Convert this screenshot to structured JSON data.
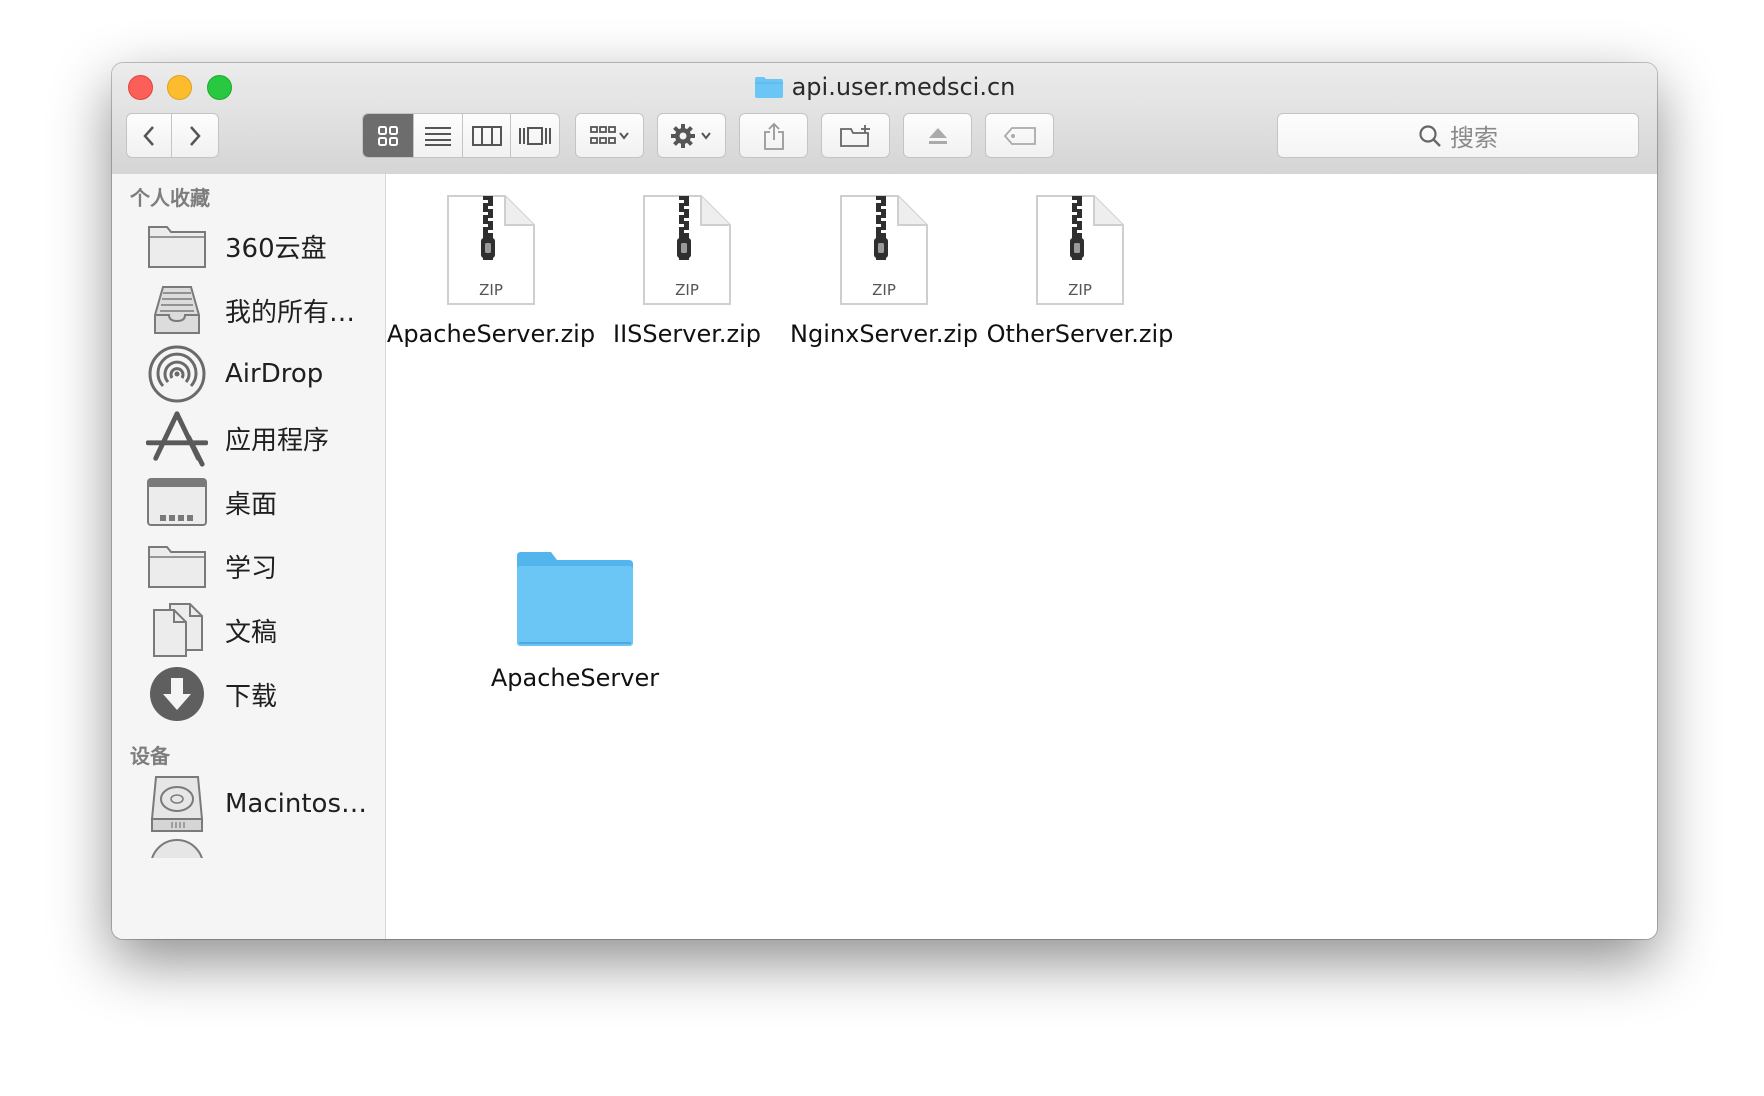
{
  "window": {
    "title": "api.user.medsci.cn"
  },
  "toolbar": {
    "search_placeholder": "搜索"
  },
  "sidebar": {
    "favorites_header": "个人收藏",
    "favorites": [
      {
        "label": "360云盘",
        "icon": "folder-icon"
      },
      {
        "label": "我的所有…",
        "icon": "all-files-icon"
      },
      {
        "label": "AirDrop",
        "icon": "airdrop-icon"
      },
      {
        "label": "应用程序",
        "icon": "applications-icon"
      },
      {
        "label": "桌面",
        "icon": "desktop-icon"
      },
      {
        "label": "学习",
        "icon": "folder-icon"
      },
      {
        "label": "文稿",
        "icon": "documents-icon"
      },
      {
        "label": "下载",
        "icon": "downloads-icon"
      }
    ],
    "devices_header": "设备",
    "devices": [
      {
        "label": "Macintos…",
        "icon": "hard-drive-icon"
      }
    ]
  },
  "files": [
    {
      "name": "ApacheServer.zip",
      "badge": "ZIP",
      "type": "zip"
    },
    {
      "name": "IISServer.zip",
      "badge": "ZIP",
      "type": "zip"
    },
    {
      "name": "NginxServer.zip",
      "badge": "ZIP",
      "type": "zip"
    },
    {
      "name": "OtherServer.zip",
      "badge": "ZIP",
      "type": "zip"
    },
    {
      "name": "ApacheServer",
      "type": "folder"
    }
  ],
  "colors": {
    "folder_blue": "#6cc6f5",
    "close": "#fc5f57",
    "minimize": "#fdbc2e",
    "maximize": "#28c840"
  }
}
